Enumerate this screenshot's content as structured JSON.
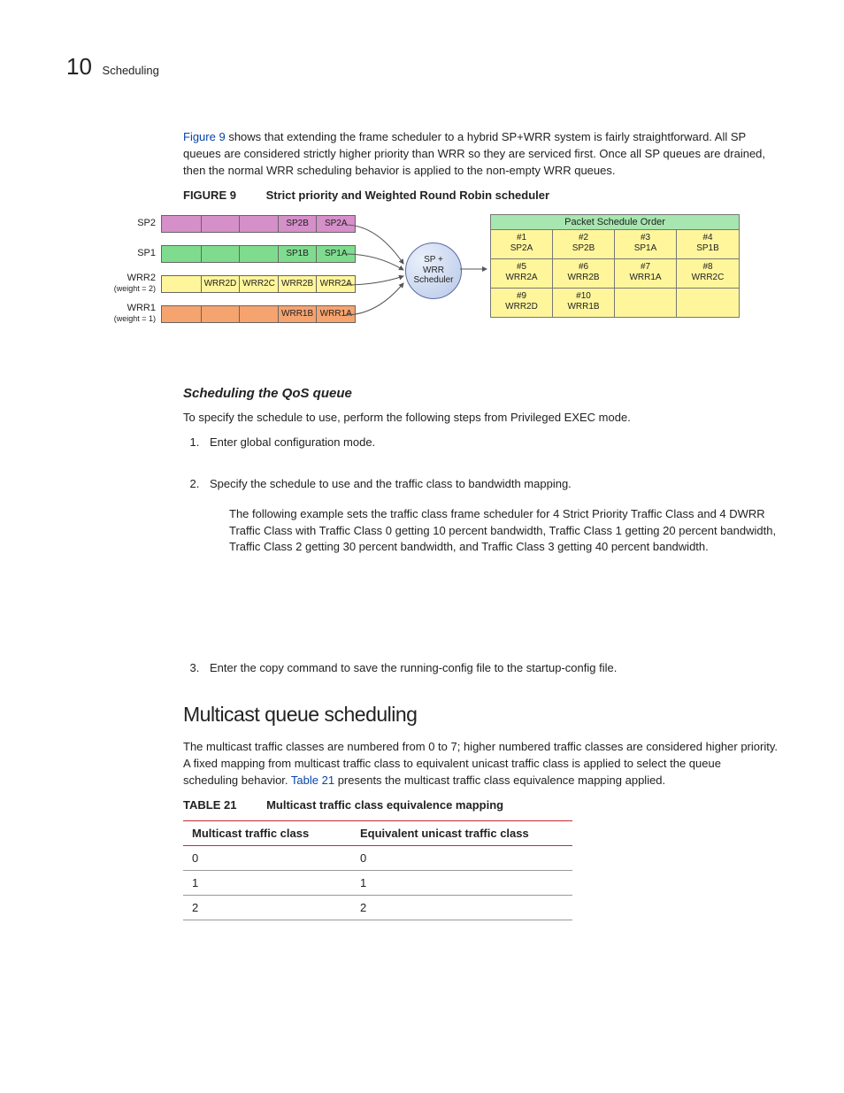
{
  "header": {
    "chapter_num": "10",
    "chapter_title": "Scheduling"
  },
  "intro": {
    "fig_ref": "Figure 9",
    "text_after": " shows that extending the frame scheduler to a hybrid SP+WRR system is fairly straightforward. All SP queues are considered strictly higher priority than WRR so they are serviced first. Once all SP queues are drained, then the normal WRR scheduling behavior is applied to the non-empty WRR queues."
  },
  "figure": {
    "label": "FIGURE 9",
    "caption": "Strict priority and Weighted Round Robin scheduler",
    "scheduler_line1": "SP +",
    "scheduler_line2": "WRR",
    "scheduler_line3": "Scheduler",
    "queues": [
      {
        "label": "SP2",
        "sub": "",
        "cls": "sp2",
        "cells": [
          "",
          "",
          "",
          "SP2B",
          "SP2A"
        ]
      },
      {
        "label": "SP1",
        "sub": "",
        "cls": "sp1",
        "cells": [
          "",
          "",
          "",
          "SP1B",
          "SP1A"
        ]
      },
      {
        "label": "WRR2",
        "sub": "(weight = 2)",
        "cls": "wrr2",
        "cells": [
          "",
          "WRR2D",
          "WRR2C",
          "WRR2B",
          "WRR2A"
        ]
      },
      {
        "label": "WRR1",
        "sub": "(weight = 1)",
        "cls": "wrr1",
        "cells": [
          "",
          "",
          "",
          "WRR1B",
          "WRR1A"
        ]
      }
    ],
    "order_title": "Packet Schedule Order",
    "order": [
      {
        "n": "#1",
        "v": "SP2A"
      },
      {
        "n": "#2",
        "v": "SP2B"
      },
      {
        "n": "#3",
        "v": "SP1A"
      },
      {
        "n": "#4",
        "v": "SP1B"
      },
      {
        "n": "#5",
        "v": "WRR2A"
      },
      {
        "n": "#6",
        "v": "WRR2B"
      },
      {
        "n": "#7",
        "v": "WRR1A"
      },
      {
        "n": "#8",
        "v": "WRR2C"
      },
      {
        "n": "#9",
        "v": "WRR2D"
      },
      {
        "n": "#10",
        "v": "WRR1B"
      },
      {
        "n": "",
        "v": ""
      },
      {
        "n": "",
        "v": ""
      }
    ]
  },
  "qos": {
    "heading": "Scheduling the QoS queue",
    "intro": "To specify the schedule to use, perform the following steps from Privileged EXEC mode.",
    "steps": [
      "Enter global configuration mode.",
      "Specify the schedule to use and the traffic class to bandwidth mapping.",
      "Enter the copy command to save the running-config file to the startup-config file."
    ],
    "example": "The following example sets the traffic class frame scheduler for 4 Strict Priority Traffic Class and 4 DWRR Traffic Class with Traffic Class 0 getting 10 percent bandwidth, Traffic Class 1 getting 20 percent bandwidth, Traffic Class 2 getting 30 percent bandwidth, and Traffic Class 3 getting 40 percent bandwidth."
  },
  "multicast": {
    "heading": "Multicast queue scheduling",
    "p_before": "The multicast traffic classes are numbered from 0 to 7; higher numbered traffic classes are considered higher priority. A fixed mapping from multicast traffic class to equivalent unicast traffic class is applied to select the queue scheduling behavior. ",
    "tbl_ref": "Table 21",
    "p_after": " presents the multicast traffic class equivalence mapping applied.",
    "table_label": "TABLE 21",
    "table_caption": "Multicast traffic class equivalence mapping",
    "columns": [
      "Multicast traffic class",
      "Equivalent unicast traffic class"
    ],
    "rows": [
      [
        "0",
        "0"
      ],
      [
        "1",
        "1"
      ],
      [
        "2",
        "2"
      ]
    ]
  }
}
